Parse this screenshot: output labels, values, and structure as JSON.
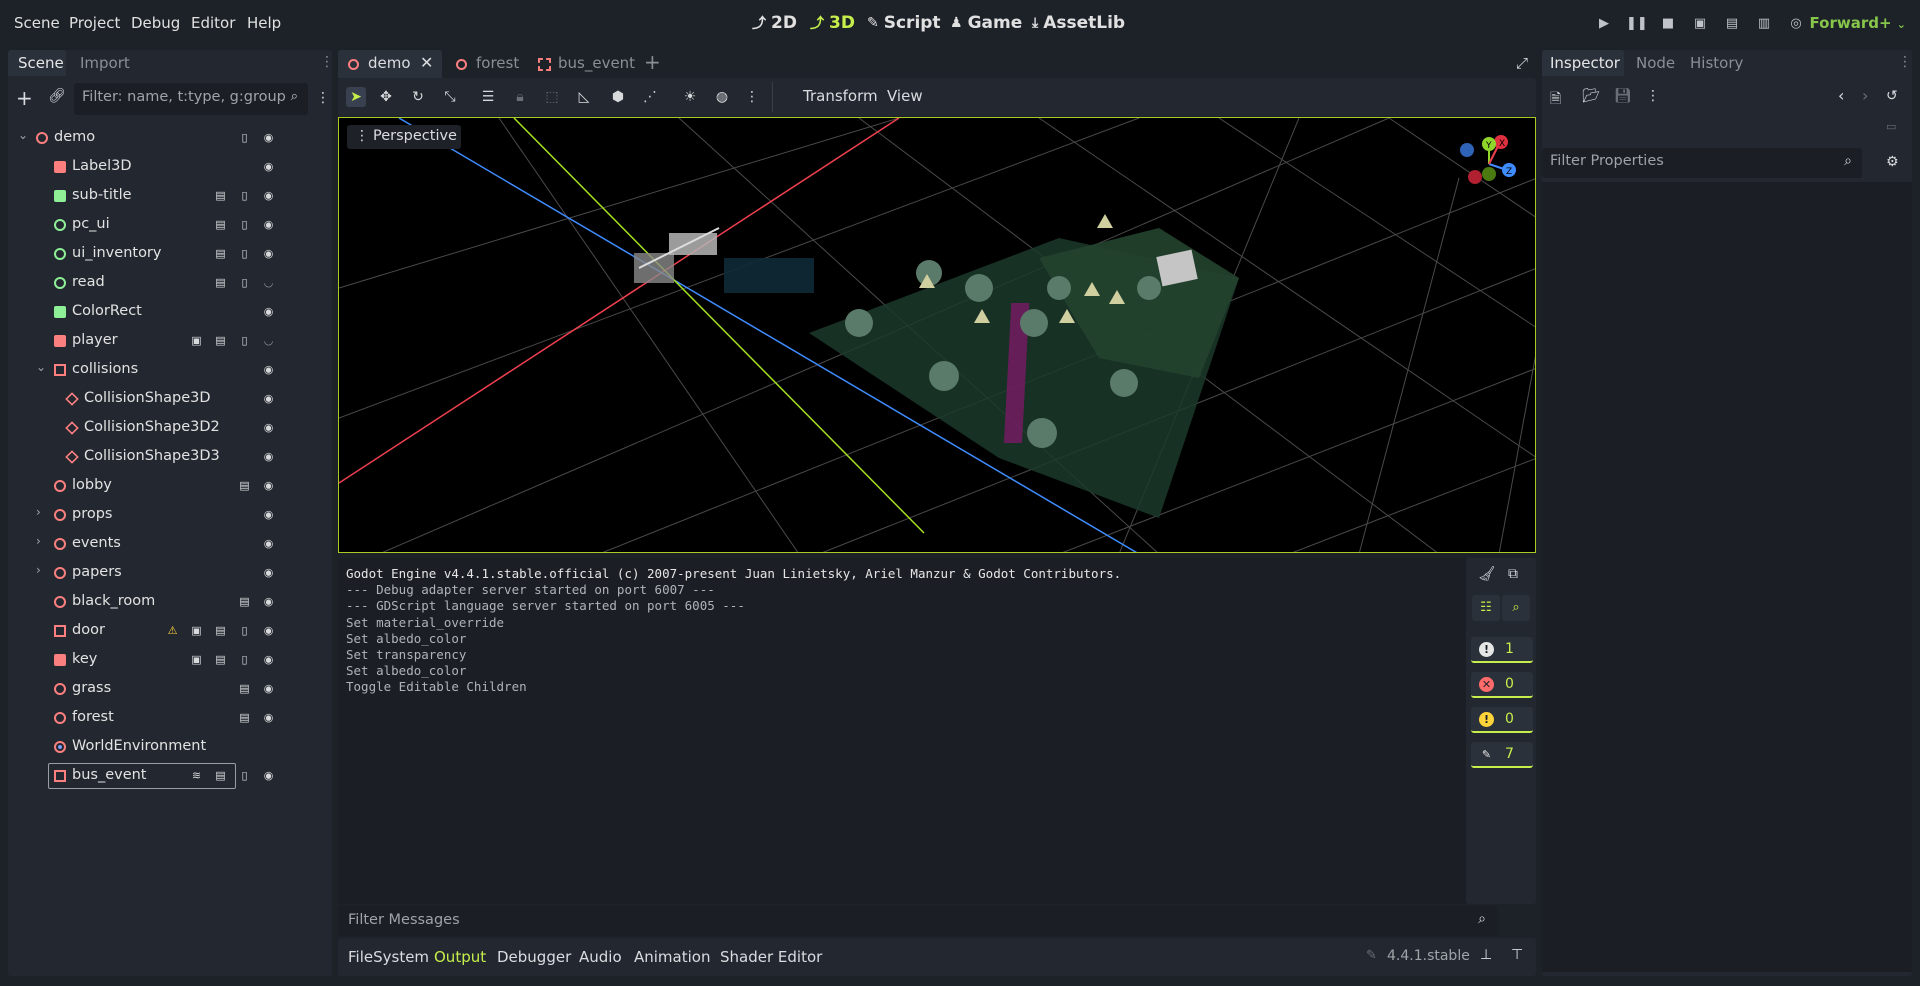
{
  "menu": [
    "Scene",
    "Project",
    "Debug",
    "Editor",
    "Help"
  ],
  "workspaces": [
    {
      "label": "2D",
      "icon": "2d-icon"
    },
    {
      "label": "3D",
      "icon": "3d-icon"
    },
    {
      "label": "Script",
      "icon": "script-icon"
    },
    {
      "label": "Game",
      "icon": "game-icon"
    },
    {
      "label": "AssetLib",
      "icon": "assetlib-icon"
    }
  ],
  "renderer": "Forward+",
  "left_dock": {
    "tabs": [
      "Scene",
      "Import"
    ],
    "filter_placeholder": "Filter: name, t:type, g:group",
    "tree": [
      {
        "label": "demo",
        "depth": 0,
        "icon": "node3d-icon",
        "arrow": "expanded"
      },
      {
        "label": "Label3D",
        "depth": 1,
        "icon": "label3d-icon"
      },
      {
        "label": "sub-title",
        "depth": 1,
        "icon": "label-icon"
      },
      {
        "label": "pc_ui",
        "depth": 1,
        "icon": "control-icon"
      },
      {
        "label": "ui_inventory",
        "depth": 1,
        "icon": "control-icon"
      },
      {
        "label": "read",
        "depth": 1,
        "icon": "control-icon"
      },
      {
        "label": "ColorRect",
        "depth": 1,
        "icon": "colorrect-icon"
      },
      {
        "label": "player",
        "depth": 1,
        "icon": "characterbody-icon"
      },
      {
        "label": "collisions",
        "depth": 1,
        "icon": "area3d-icon",
        "arrow": "expanded"
      },
      {
        "label": "CollisionShape3D",
        "depth": 2,
        "icon": "collisionshape-icon"
      },
      {
        "label": "CollisionShape3D2",
        "depth": 2,
        "icon": "collisionshape-icon"
      },
      {
        "label": "CollisionShape3D3",
        "depth": 2,
        "icon": "collisionshape-icon"
      },
      {
        "label": "lobby",
        "depth": 1,
        "icon": "node3d-icon"
      },
      {
        "label": "props",
        "depth": 1,
        "icon": "node3d-icon",
        "arrow": "collapsed"
      },
      {
        "label": "events",
        "depth": 1,
        "icon": "node3d-icon",
        "arrow": "collapsed"
      },
      {
        "label": "papers",
        "depth": 1,
        "icon": "node3d-icon",
        "arrow": "collapsed"
      },
      {
        "label": "black_room",
        "depth": 1,
        "icon": "node3d-icon"
      },
      {
        "label": "door",
        "depth": 1,
        "icon": "area3d-icon"
      },
      {
        "label": "key",
        "depth": 1,
        "icon": "rigidbody-icon"
      },
      {
        "label": "grass",
        "depth": 1,
        "icon": "node3d-icon"
      },
      {
        "label": "forest",
        "depth": 1,
        "icon": "node3d-icon"
      },
      {
        "label": "WorldEnvironment",
        "depth": 1,
        "icon": "worldenv-icon"
      },
      {
        "label": "bus_event",
        "depth": 1,
        "icon": "area3d-icon"
      }
    ]
  },
  "scene_tabs": [
    {
      "label": "demo",
      "active": true
    },
    {
      "label": "forest",
      "active": false
    },
    {
      "label": "bus_event",
      "active": false
    }
  ],
  "toolbar": {
    "transform_label": "Transform",
    "view_label": "View"
  },
  "viewport": {
    "mode_label": "Perspective",
    "gizmo": {
      "x": "X",
      "y": "Y",
      "z": "Z"
    }
  },
  "output": {
    "lines": [
      "Godot Engine v4.4.1.stable.official (c) 2007-present Juan Linietsky, Ariel Manzur & Godot Contributors.",
      "--- Debug adapter server started on port 6007 ---",
      "--- GDScript language server started on port 6005 ---",
      "Set material_override",
      "Set albedo_color",
      "Set transparency",
      "Set albedo_color",
      "Toggle Editable Children"
    ],
    "filter_placeholder": "Filter Messages",
    "counters": [
      {
        "icon": "message-icon",
        "value": "1"
      },
      {
        "icon": "error-icon",
        "value": "0"
      },
      {
        "icon": "warning-icon",
        "value": "0"
      },
      {
        "icon": "editor-message-icon",
        "value": "7"
      }
    ]
  },
  "bottom_tabs": [
    "FileSystem",
    "Output",
    "Debugger",
    "Audio",
    "Animation",
    "Shader Editor"
  ],
  "bottom_active": "Output",
  "version": "4.4.1.stable",
  "inspector": {
    "tabs": [
      "Inspector",
      "Node",
      "History"
    ],
    "filter_placeholder": "Filter Properties"
  },
  "colors": {
    "accent": "#c6ef4b",
    "node3d": "#fc7f7f",
    "control": "#8eef97",
    "panel": "#232830",
    "bg": "#1d2229"
  }
}
